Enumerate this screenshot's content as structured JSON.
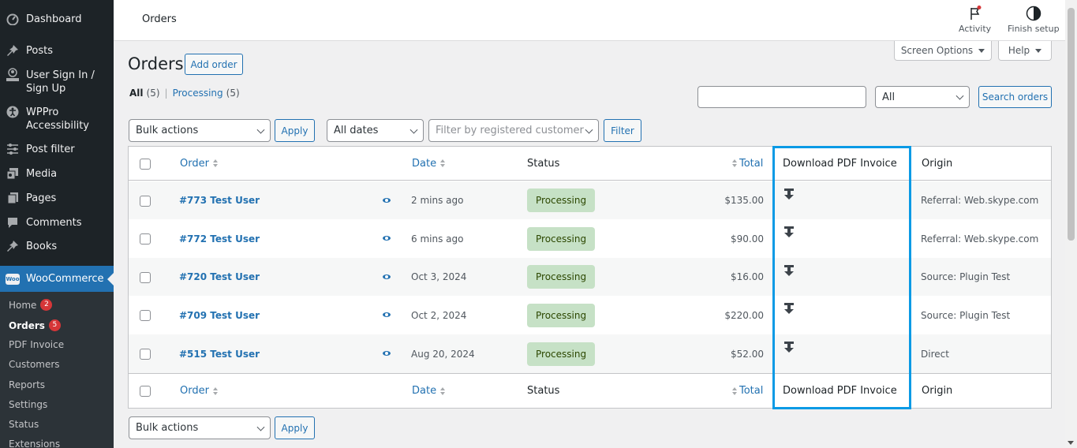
{
  "sidebar": {
    "items": [
      {
        "label": "Dashboard",
        "icon": "dashboard-icon"
      },
      {
        "label": "Posts",
        "icon": "pin-icon"
      },
      {
        "label": "User Sign In /\nSign Up",
        "icon": "user-icon"
      },
      {
        "label": "WPPro\nAccessibility",
        "icon": "accessibility-icon"
      },
      {
        "label": "Post filter",
        "icon": "filter-icon"
      },
      {
        "label": "Media",
        "icon": "media-icon"
      },
      {
        "label": "Pages",
        "icon": "pages-icon"
      },
      {
        "label": "Comments",
        "icon": "comment-icon"
      },
      {
        "label": "Books",
        "icon": "pin-icon"
      }
    ],
    "woocommerce": {
      "label": "WooCommerce",
      "logo_text": "Woo"
    },
    "submenu": [
      {
        "label": "Home",
        "badge": "2"
      },
      {
        "label": "Orders",
        "badge": "5"
      },
      {
        "label": "PDF Invoice"
      },
      {
        "label": "Customers"
      },
      {
        "label": "Reports"
      },
      {
        "label": "Settings"
      },
      {
        "label": "Status"
      },
      {
        "label": "Extensions"
      }
    ]
  },
  "header": {
    "title": "Orders",
    "activity_label": "Activity",
    "finish_setup_label": "Finish setup"
  },
  "page": {
    "heading": "Orders",
    "add_order": "Add order",
    "screen_options": "Screen Options",
    "help": "Help",
    "views": {
      "all_label": "All",
      "all_count": "(5)",
      "separator": "|",
      "processing_label": "Processing",
      "processing_count": "(5)"
    },
    "search": {
      "value": "",
      "placeholder": "",
      "status_select": "All",
      "button": "Search orders"
    },
    "bulk_actions": "Bulk actions",
    "apply": "Apply",
    "dates_select": "All dates",
    "customer_filter_placeholder": "Filter by registered customer",
    "filter_button": "Filter"
  },
  "table": {
    "columns": {
      "order": "Order",
      "date": "Date",
      "status": "Status",
      "total": "Total",
      "download": "Download PDF Invoice",
      "origin": "Origin"
    },
    "rows": [
      {
        "order": "#773 Test User",
        "date": "2 mins ago",
        "status": "Processing",
        "total": "$135.00",
        "origin": "Referral: Web.skype.com"
      },
      {
        "order": "#772 Test User",
        "date": "6 mins ago",
        "status": "Processing",
        "total": "$90.00",
        "origin": "Referral: Web.skype.com"
      },
      {
        "order": "#720 Test User",
        "date": "Oct 3, 2024",
        "status": "Processing",
        "total": "$16.00",
        "origin": "Source: Plugin Test"
      },
      {
        "order": "#709 Test User",
        "date": "Oct 2, 2024",
        "status": "Processing",
        "total": "$220.00",
        "origin": "Source: Plugin Test"
      },
      {
        "order": "#515 Test User",
        "date": "Aug 20, 2024",
        "status": "Processing",
        "total": "$52.00",
        "origin": "Direct"
      }
    ]
  },
  "colors": {
    "accent": "#2271b1",
    "highlight_border": "#0a9ae5",
    "status_processing_bg": "#c6e1c6",
    "badge": "#d63638"
  }
}
